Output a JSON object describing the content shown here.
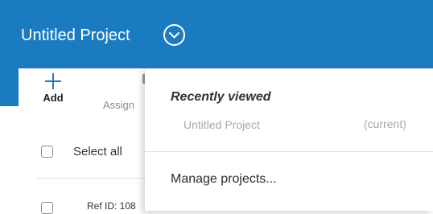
{
  "header": {
    "title": "Untitled Project",
    "dropdown_icon": "chevron-down-circle-icon",
    "background_color": "#1a7bc1"
  },
  "toolbar": {
    "add_label": "Add",
    "add_icon": "plus-icon",
    "assign_label": "Assign",
    "assign_icon": "assign-icon"
  },
  "list": {
    "select_all_label": "Select all",
    "rows": [
      {
        "ref_label": "Ref ID: 108"
      }
    ]
  },
  "dropdown": {
    "recent_heading": "Recently viewed",
    "recent_items": [
      {
        "name": "Untitled Project",
        "status": "(current)"
      }
    ],
    "manage_label": "Manage projects..."
  }
}
